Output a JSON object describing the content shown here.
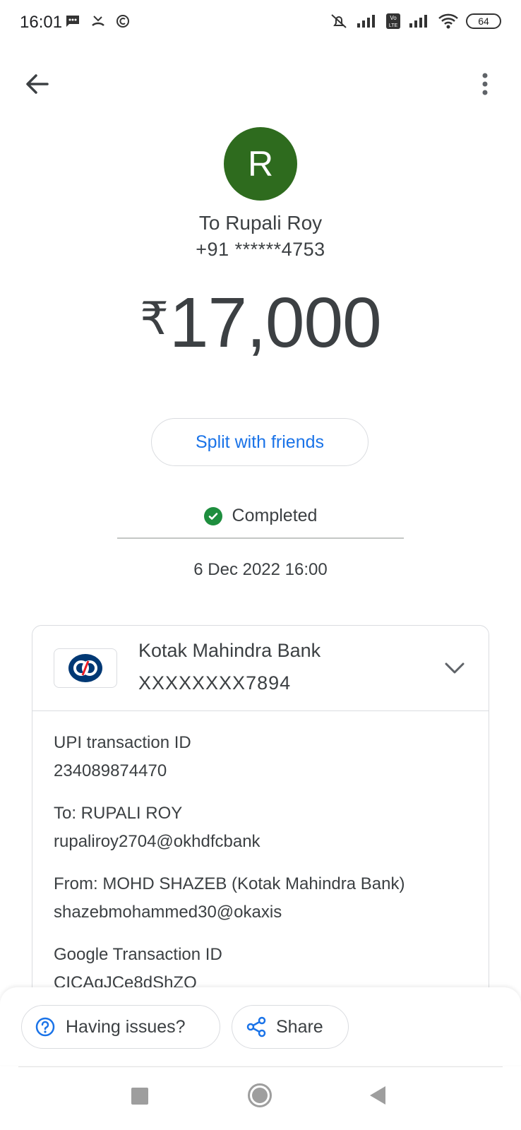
{
  "status_bar": {
    "time": "16:01",
    "battery": "64"
  },
  "transaction": {
    "avatar_initial": "R",
    "recipient_name": "To Rupali Roy",
    "recipient_phone": "+91 ******4753",
    "currency_symbol": "₹",
    "amount": "17,000",
    "split_label": "Split with friends",
    "status": "Completed",
    "datetime": "6 Dec 2022 16:00"
  },
  "bank": {
    "name": "Kotak Mahindra Bank",
    "account": "XXXXXXXX7894"
  },
  "details": [
    {
      "label": "UPI transaction ID",
      "value": "234089874470"
    },
    {
      "label": "To: RUPALI ROY",
      "value": "rupaliroy2704@okhdfcbank"
    },
    {
      "label": "From: MOHD  SHAZEB (Kotak Mahindra Bank)",
      "value": "shazebmohammed30@okaxis"
    },
    {
      "label": "Google Transaction ID",
      "value": "CICAgJCe8dShZQ"
    }
  ],
  "actions": {
    "issues_label": "Having issues?",
    "share_label": "Share"
  },
  "colors": {
    "accent": "#1a73e8",
    "avatar": "#2e6b1e",
    "success": "#1e8e3e"
  },
  "icons": [
    "back-arrow-icon",
    "more-vert-icon",
    "check-circle-icon",
    "chevron-down-icon",
    "help-circle-icon",
    "share-icon"
  ]
}
